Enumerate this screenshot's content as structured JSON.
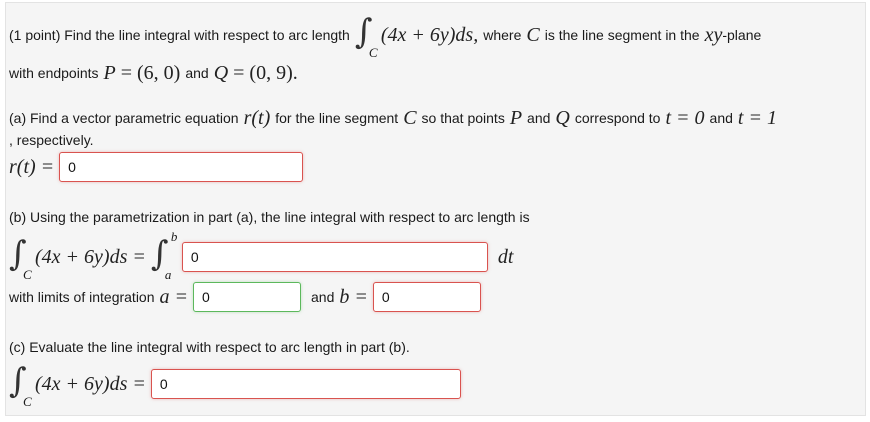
{
  "problem": {
    "intro_point": "(1 point) Find the line integral with respect to arc length",
    "integrand": "(4x + 6y)ds,",
    "where_text": "where",
    "C_var": "C",
    "is_segment_text": "is the line segment in the",
    "plane_var": "xy",
    "plane_suffix": "-plane",
    "endpoints_text": "with endpoints",
    "P_label": "P",
    "P_value": "= (6, 0)",
    "and_text": "and",
    "Q_label": "Q",
    "Q_value": "= (0, 9)."
  },
  "part_a": {
    "text_start": "(a) Find a vector parametric equation",
    "r_of_t": "r(t)",
    "text_mid": "for the line segment",
    "C_var": "C",
    "text_mid2": "so that points",
    "P_label": "P",
    "and_text": "and",
    "Q_label": "Q",
    "text_correspond": "correspond to",
    "t0": "t = 0",
    "and2": "and",
    "t1": "t = 1",
    "respectively": ", respectively.",
    "lhs": "r(t) =",
    "answer_value": "0"
  },
  "part_b": {
    "text": "(b) Using the parametrization in part (a), the line integral with respect to arc length is",
    "lhs_integrand": "(4x + 6y)ds =",
    "lower_C": "C",
    "upper_b": "b",
    "lower_a": "a",
    "answer_value": "0",
    "dt": "dt",
    "limits_text": "with limits of integration",
    "a_eq": "a =",
    "a_value": "0",
    "and_text": "and",
    "b_eq": "b =",
    "b_value": "0"
  },
  "part_c": {
    "text": "(c) Evaluate the line integral with respect to arc length in part (b).",
    "lhs_integrand": "(4x + 6y)ds =",
    "lower_C": "C",
    "answer_value": "0"
  },
  "colors": {
    "error_border": "#d9534f",
    "correct_border": "#5cb85c",
    "panel_bg": "#f5f5f5"
  }
}
